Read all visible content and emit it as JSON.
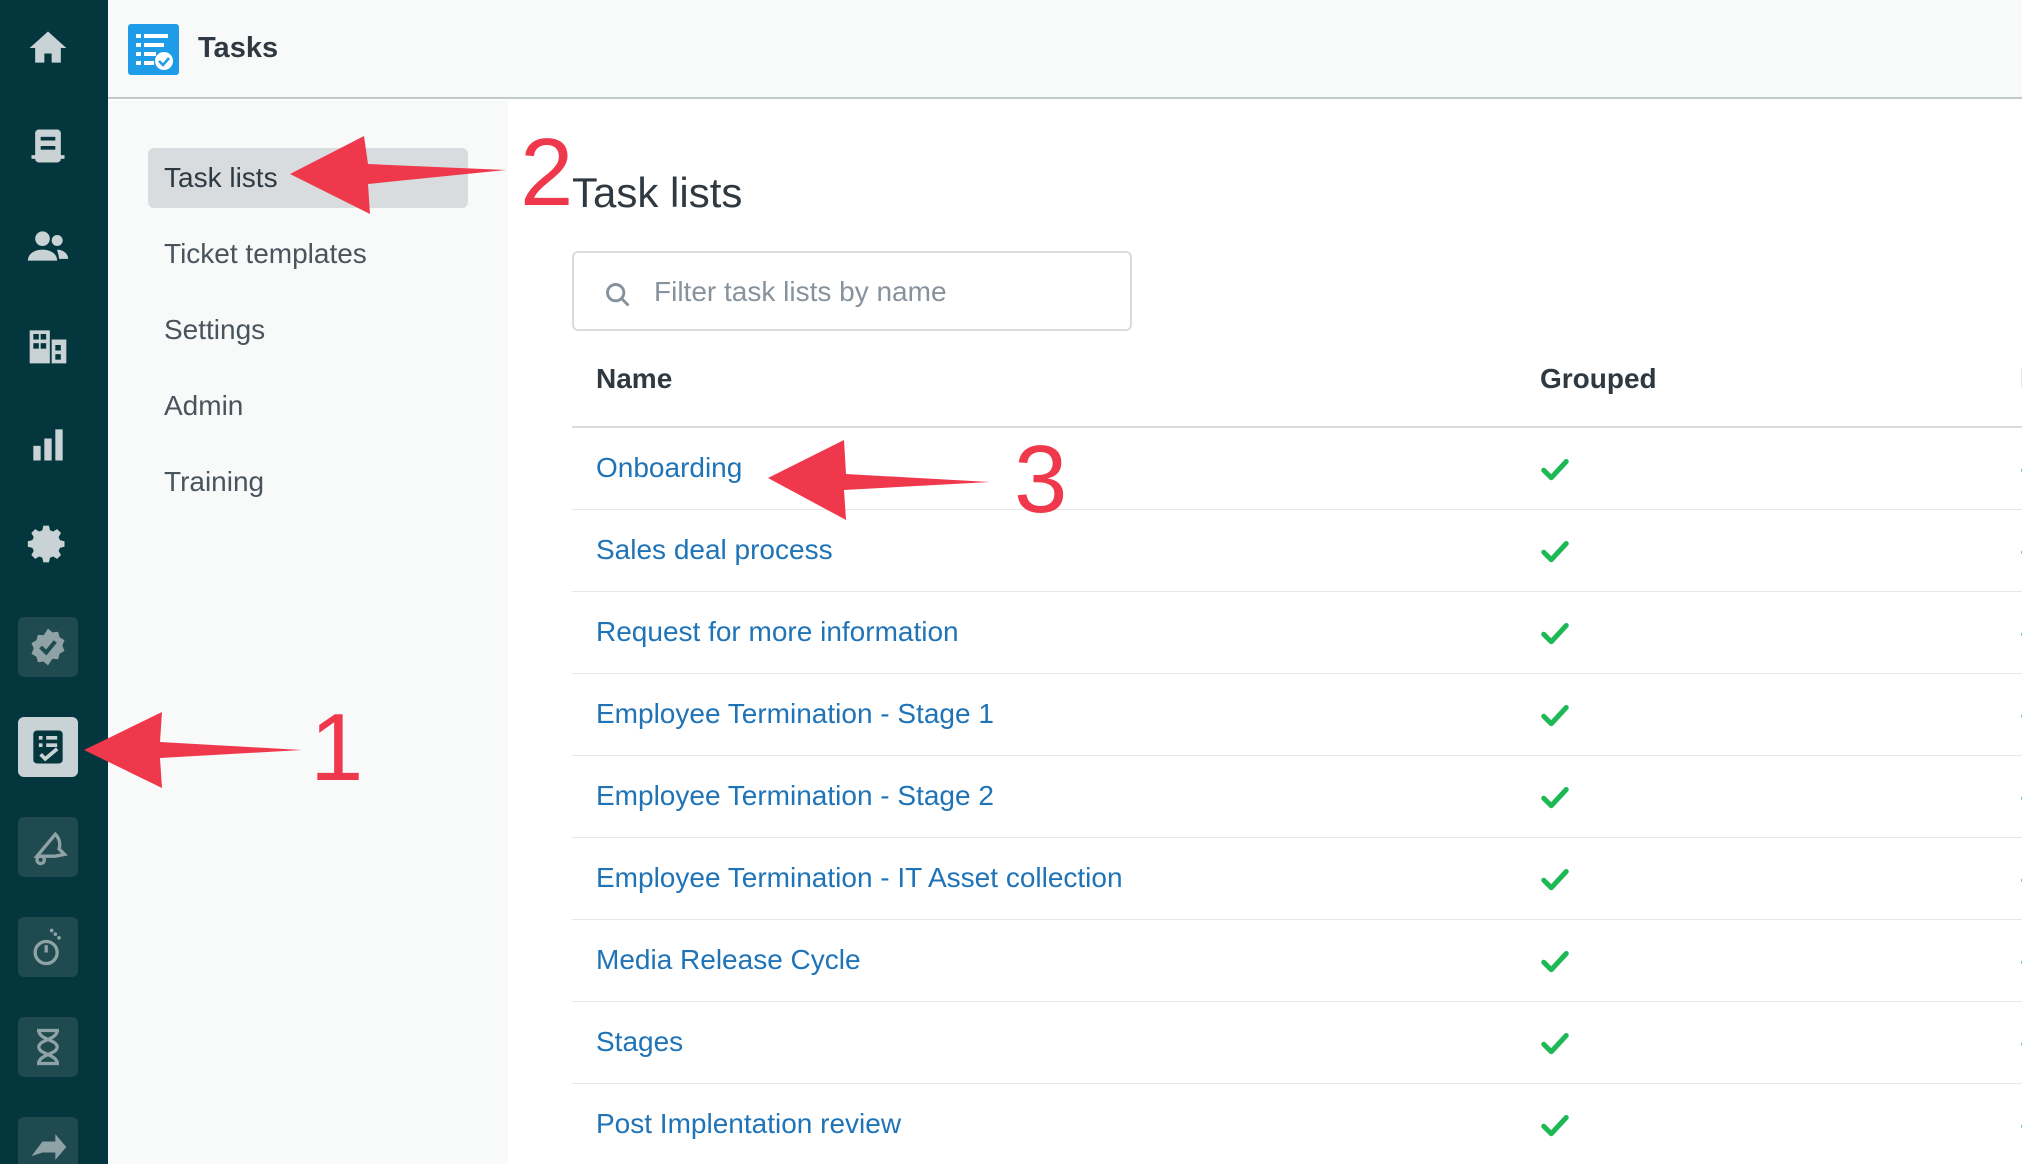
{
  "app": {
    "title": "Tasks"
  },
  "rail": {
    "items": [
      {
        "icon": "home-icon"
      },
      {
        "icon": "views-icon"
      },
      {
        "icon": "customers-icon"
      },
      {
        "icon": "organizations-icon"
      },
      {
        "icon": "reporting-icon"
      },
      {
        "icon": "admin-gear-icon"
      },
      {
        "icon": "verified-badge-icon"
      },
      {
        "icon": "tasks-icon"
      },
      {
        "icon": "notification-bell-icon"
      },
      {
        "icon": "timer-icon"
      },
      {
        "icon": "hourglass-icon"
      },
      {
        "icon": "forward-arrow-icon"
      }
    ]
  },
  "subnav": {
    "items": [
      {
        "label": "Task lists"
      },
      {
        "label": "Ticket templates"
      },
      {
        "label": "Settings"
      },
      {
        "label": "Admin"
      },
      {
        "label": "Training"
      }
    ]
  },
  "main": {
    "title": "Task lists",
    "search_placeholder": "Filter task lists by name",
    "columns": {
      "name": "Name",
      "grouped": "Grouped"
    },
    "rows": [
      {
        "name": "Onboarding",
        "grouped": true
      },
      {
        "name": "Sales deal process",
        "grouped": true
      },
      {
        "name": "Request for more information",
        "grouped": true
      },
      {
        "name": "Employee Termination - Stage 1",
        "grouped": true
      },
      {
        "name": "Employee Termination - Stage 2",
        "grouped": true
      },
      {
        "name": "Employee Termination - IT Asset collection",
        "grouped": true
      },
      {
        "name": "Media Release Cycle",
        "grouped": true
      },
      {
        "name": "Stages",
        "grouped": true
      },
      {
        "name": "Post Implentation review",
        "grouped": true
      }
    ]
  },
  "annotations": [
    {
      "number": "1"
    },
    {
      "number": "2"
    },
    {
      "number": "3"
    }
  ],
  "colors": {
    "rail": "#03363d",
    "link": "#1f73b7",
    "check": "#1db954",
    "annotation": "#f0384c"
  }
}
